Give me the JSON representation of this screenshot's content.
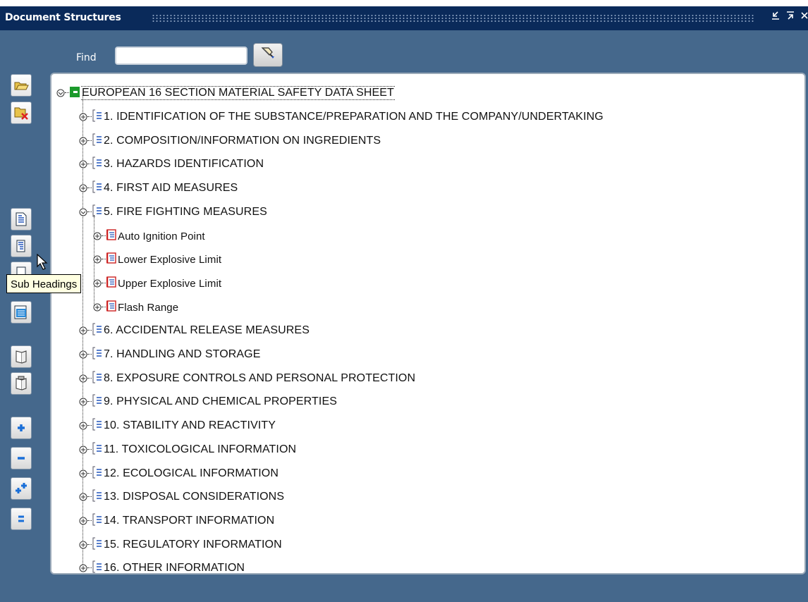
{
  "window": {
    "title": "Document Structures",
    "controls": [
      "minimize-icon",
      "maximize-icon",
      "close-icon"
    ]
  },
  "find": {
    "label": "Find",
    "value": "",
    "button_icon": "flashlight-search-icon"
  },
  "toolbar": {
    "tools": [
      {
        "icon": "open-folder-icon"
      },
      {
        "icon": "delete-folder-icon"
      },
      {
        "icon": "document-heading-icon"
      },
      {
        "icon": "sub-headings-icon"
      },
      {
        "icon": "sub-headings-icon"
      },
      {
        "icon": "properties-icon"
      },
      {
        "icon": "copy-icon"
      },
      {
        "icon": "paste-icon"
      },
      {
        "icon": "expand-icon"
      },
      {
        "icon": "collapse-icon"
      },
      {
        "icon": "expand-all-icon"
      },
      {
        "icon": "collapse-all-icon"
      }
    ]
  },
  "tooltip": {
    "text": "Sub Headings"
  },
  "tree": {
    "root": "EUROPEAN 16 SECTION MATERIAL SAFETY DATA SHEET",
    "sections": [
      {
        "label": "1. IDENTIFICATION OF THE SUBSTANCE/PREPARATION AND THE COMPANY/UNDERTAKING",
        "expanded": false
      },
      {
        "label": "2. COMPOSITION/INFORMATION ON INGREDIENTS",
        "expanded": false
      },
      {
        "label": "3. HAZARDS IDENTIFICATION",
        "expanded": false
      },
      {
        "label": "4. FIRST AID MEASURES",
        "expanded": false
      },
      {
        "label": "5. FIRE FIGHTING MEASURES",
        "expanded": true,
        "children": [
          "Auto Ignition Point",
          "Lower Explosive Limit",
          "Upper Explosive Limit",
          "Flash Range"
        ]
      },
      {
        "label": "6. ACCIDENTAL RELEASE MEASURES",
        "expanded": false
      },
      {
        "label": "7. HANDLING AND STORAGE",
        "expanded": false
      },
      {
        "label": "8. EXPOSURE CONTROLS AND PERSONAL PROTECTION",
        "expanded": false
      },
      {
        "label": "9. PHYSICAL AND CHEMICAL PROPERTIES",
        "expanded": false
      },
      {
        "label": "10. STABILITY AND REACTIVITY",
        "expanded": false
      },
      {
        "label": "11. TOXICOLOGICAL INFORMATION",
        "expanded": false
      },
      {
        "label": "12. ECOLOGICAL INFORMATION",
        "expanded": false
      },
      {
        "label": "13. DISPOSAL CONSIDERATIONS",
        "expanded": false
      },
      {
        "label": "14. TRANSPORT INFORMATION",
        "expanded": false
      },
      {
        "label": "15. REGULATORY INFORMATION",
        "expanded": false
      },
      {
        "label": "16. OTHER INFORMATION",
        "expanded": false
      }
    ]
  },
  "colors": {
    "titlebar": "#0a2a5a",
    "window_bg": "#45688c",
    "tooltip_bg": "#ffffe1",
    "root_icon": "#1c9a2c",
    "subheading_icon": "#cc2222"
  }
}
